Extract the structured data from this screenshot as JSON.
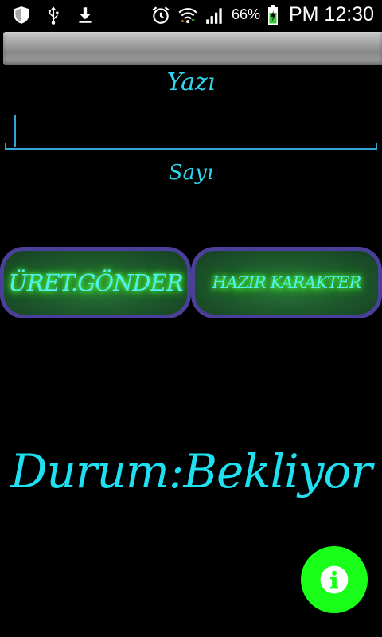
{
  "status_bar": {
    "battery_percent": "66%",
    "time": "PM 12:30",
    "icons_left": [
      "shield-icon",
      "usb-icon",
      "download-icon"
    ],
    "icons_right": [
      "alarm-icon",
      "wifi-icon",
      "signal-icon",
      "battery-charging-icon"
    ]
  },
  "form": {
    "text_label": "Yazı",
    "text_value": "",
    "number_label": "Sayı"
  },
  "buttons": {
    "generate_send": "ÜRET.GÖNDER",
    "ready_character": "HAZIR KARAKTER"
  },
  "status": {
    "text": "Durum:Bekliyor"
  },
  "fab": {
    "icon": "info-icon"
  },
  "colors": {
    "label_cyan": "#2fd4ec",
    "button_border": "#4a3f9a",
    "button_text": "#4ff0f0",
    "fab_green": "#1aff1a",
    "field_blue": "#33a8d8"
  }
}
